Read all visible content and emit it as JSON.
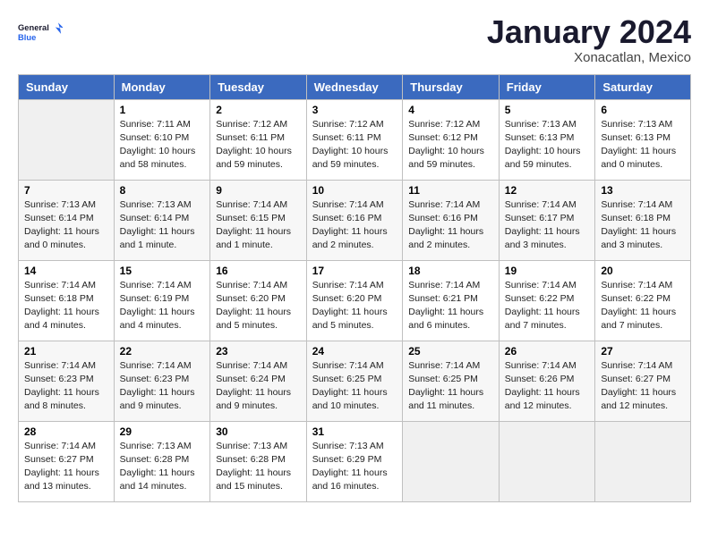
{
  "logo": {
    "line1": "General",
    "line2": "Blue"
  },
  "title": "January 2024",
  "subtitle": "Xonacatlan, Mexico",
  "headers": [
    "Sunday",
    "Monday",
    "Tuesday",
    "Wednesday",
    "Thursday",
    "Friday",
    "Saturday"
  ],
  "weeks": [
    [
      {
        "day": "",
        "info": ""
      },
      {
        "day": "1",
        "info": "Sunrise: 7:11 AM\nSunset: 6:10 PM\nDaylight: 10 hours\nand 58 minutes."
      },
      {
        "day": "2",
        "info": "Sunrise: 7:12 AM\nSunset: 6:11 PM\nDaylight: 10 hours\nand 59 minutes."
      },
      {
        "day": "3",
        "info": "Sunrise: 7:12 AM\nSunset: 6:11 PM\nDaylight: 10 hours\nand 59 minutes."
      },
      {
        "day": "4",
        "info": "Sunrise: 7:12 AM\nSunset: 6:12 PM\nDaylight: 10 hours\nand 59 minutes."
      },
      {
        "day": "5",
        "info": "Sunrise: 7:13 AM\nSunset: 6:13 PM\nDaylight: 10 hours\nand 59 minutes."
      },
      {
        "day": "6",
        "info": "Sunrise: 7:13 AM\nSunset: 6:13 PM\nDaylight: 11 hours\nand 0 minutes."
      }
    ],
    [
      {
        "day": "7",
        "info": "Sunrise: 7:13 AM\nSunset: 6:14 PM\nDaylight: 11 hours\nand 0 minutes."
      },
      {
        "day": "8",
        "info": "Sunrise: 7:13 AM\nSunset: 6:14 PM\nDaylight: 11 hours\nand 1 minute."
      },
      {
        "day": "9",
        "info": "Sunrise: 7:14 AM\nSunset: 6:15 PM\nDaylight: 11 hours\nand 1 minute."
      },
      {
        "day": "10",
        "info": "Sunrise: 7:14 AM\nSunset: 6:16 PM\nDaylight: 11 hours\nand 2 minutes."
      },
      {
        "day": "11",
        "info": "Sunrise: 7:14 AM\nSunset: 6:16 PM\nDaylight: 11 hours\nand 2 minutes."
      },
      {
        "day": "12",
        "info": "Sunrise: 7:14 AM\nSunset: 6:17 PM\nDaylight: 11 hours\nand 3 minutes."
      },
      {
        "day": "13",
        "info": "Sunrise: 7:14 AM\nSunset: 6:18 PM\nDaylight: 11 hours\nand 3 minutes."
      }
    ],
    [
      {
        "day": "14",
        "info": "Sunrise: 7:14 AM\nSunset: 6:18 PM\nDaylight: 11 hours\nand 4 minutes."
      },
      {
        "day": "15",
        "info": "Sunrise: 7:14 AM\nSunset: 6:19 PM\nDaylight: 11 hours\nand 4 minutes."
      },
      {
        "day": "16",
        "info": "Sunrise: 7:14 AM\nSunset: 6:20 PM\nDaylight: 11 hours\nand 5 minutes."
      },
      {
        "day": "17",
        "info": "Sunrise: 7:14 AM\nSunset: 6:20 PM\nDaylight: 11 hours\nand 5 minutes."
      },
      {
        "day": "18",
        "info": "Sunrise: 7:14 AM\nSunset: 6:21 PM\nDaylight: 11 hours\nand 6 minutes."
      },
      {
        "day": "19",
        "info": "Sunrise: 7:14 AM\nSunset: 6:22 PM\nDaylight: 11 hours\nand 7 minutes."
      },
      {
        "day": "20",
        "info": "Sunrise: 7:14 AM\nSunset: 6:22 PM\nDaylight: 11 hours\nand 7 minutes."
      }
    ],
    [
      {
        "day": "21",
        "info": "Sunrise: 7:14 AM\nSunset: 6:23 PM\nDaylight: 11 hours\nand 8 minutes."
      },
      {
        "day": "22",
        "info": "Sunrise: 7:14 AM\nSunset: 6:23 PM\nDaylight: 11 hours\nand 9 minutes."
      },
      {
        "day": "23",
        "info": "Sunrise: 7:14 AM\nSunset: 6:24 PM\nDaylight: 11 hours\nand 9 minutes."
      },
      {
        "day": "24",
        "info": "Sunrise: 7:14 AM\nSunset: 6:25 PM\nDaylight: 11 hours\nand 10 minutes."
      },
      {
        "day": "25",
        "info": "Sunrise: 7:14 AM\nSunset: 6:25 PM\nDaylight: 11 hours\nand 11 minutes."
      },
      {
        "day": "26",
        "info": "Sunrise: 7:14 AM\nSunset: 6:26 PM\nDaylight: 11 hours\nand 12 minutes."
      },
      {
        "day": "27",
        "info": "Sunrise: 7:14 AM\nSunset: 6:27 PM\nDaylight: 11 hours\nand 12 minutes."
      }
    ],
    [
      {
        "day": "28",
        "info": "Sunrise: 7:14 AM\nSunset: 6:27 PM\nDaylight: 11 hours\nand 13 minutes."
      },
      {
        "day": "29",
        "info": "Sunrise: 7:13 AM\nSunset: 6:28 PM\nDaylight: 11 hours\nand 14 minutes."
      },
      {
        "day": "30",
        "info": "Sunrise: 7:13 AM\nSunset: 6:28 PM\nDaylight: 11 hours\nand 15 minutes."
      },
      {
        "day": "31",
        "info": "Sunrise: 7:13 AM\nSunset: 6:29 PM\nDaylight: 11 hours\nand 16 minutes."
      },
      {
        "day": "",
        "info": ""
      },
      {
        "day": "",
        "info": ""
      },
      {
        "day": "",
        "info": ""
      }
    ]
  ]
}
